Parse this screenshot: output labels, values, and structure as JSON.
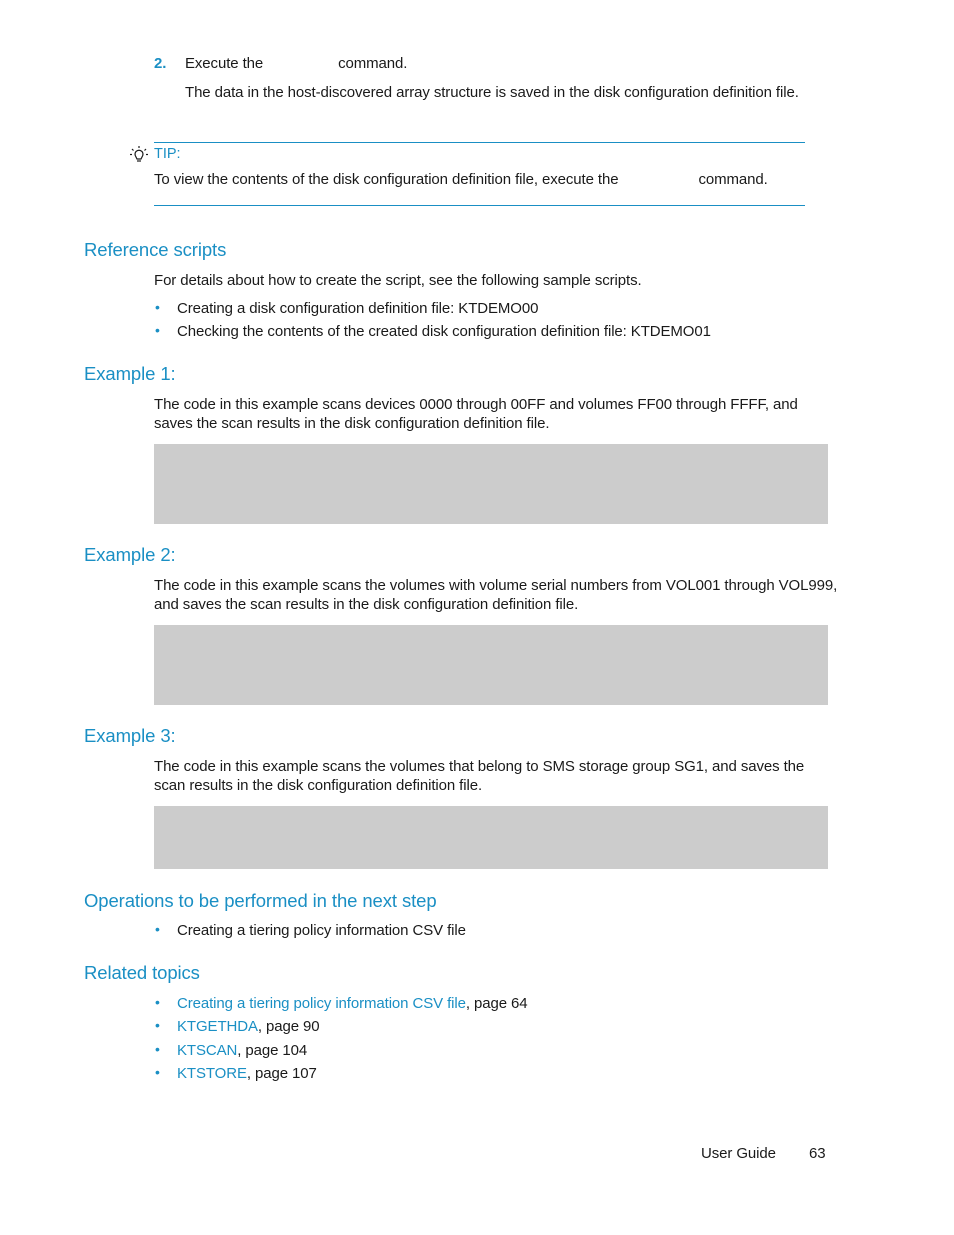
{
  "step2": {
    "number": "2.",
    "text_before": "Execute the",
    "text_after": "command.",
    "description": "The data in the host-discovered array structure is saved in the disk configuration definition file."
  },
  "tip": {
    "icon": "lightbulb-icon",
    "label": "TIP:",
    "text_before": "To view the contents of the disk configuration definition file, execute the",
    "text_after": "command."
  },
  "reference_scripts": {
    "heading": "Reference scripts",
    "intro": "For details about how to create the script, see the following sample scripts.",
    "items": [
      "Creating a disk configuration definition file: KTDEMO00",
      "Checking the contents of the created disk configuration definition file: KTDEMO01"
    ]
  },
  "examples": [
    {
      "heading": "Example 1:",
      "line1": "The code in this example scans devices 0000 through 00FF and volumes FF00 through FFFF, and",
      "line2": "saves the scan results in the disk configuration definition file."
    },
    {
      "heading": "Example 2:",
      "line1": "The code in this example scans the volumes with volume serial numbers from VOL001 through VOL999,",
      "line2": "and saves the scan results in the disk configuration definition file."
    },
    {
      "heading": "Example 3:",
      "line1": "The code in this example scans the volumes that belong to SMS storage group SG1, and saves the",
      "line2": "scan results in the disk configuration definition file."
    }
  ],
  "next_step": {
    "heading": "Operations to be performed in the next step",
    "items": [
      "Creating a tiering policy information CSV file"
    ]
  },
  "related_topics": {
    "heading": "Related topics",
    "items": [
      {
        "link": "Creating a tiering policy information CSV file",
        "suffix": ", page 64"
      },
      {
        "link": "KTGETHDA",
        "suffix": ", page 90"
      },
      {
        "link": "KTSCAN",
        "suffix": ", page 104"
      },
      {
        "link": "KTSTORE",
        "suffix": ", page 107"
      }
    ]
  },
  "footer": {
    "guide_title": "User Guide",
    "page_number": "63"
  },
  "colors": {
    "accent": "#1a8fc4",
    "code_box": "#cccccc",
    "text": "#1a1a1a"
  }
}
